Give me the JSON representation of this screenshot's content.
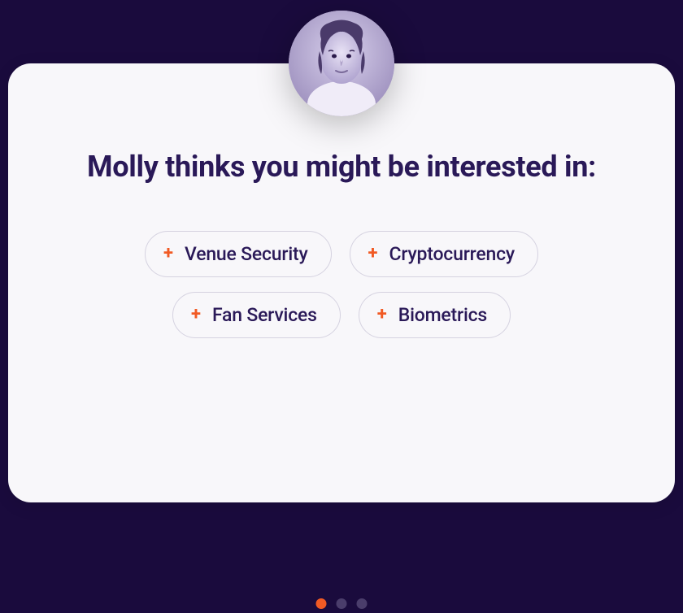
{
  "heading": "Molly thinks you might be interested in:",
  "chips": [
    {
      "label": "Venue Security"
    },
    {
      "label": "Cryptocurrency"
    },
    {
      "label": "Fan Services"
    },
    {
      "label": "Biometrics"
    }
  ],
  "pagination": {
    "total": 3,
    "active_index": 0
  },
  "colors": {
    "background": "#1a0b3d",
    "card": "#f8f7fa",
    "text": "#2a1958",
    "accent": "#f15a24",
    "border": "#d5d2e0",
    "dot_inactive": "#4a3d6b"
  }
}
